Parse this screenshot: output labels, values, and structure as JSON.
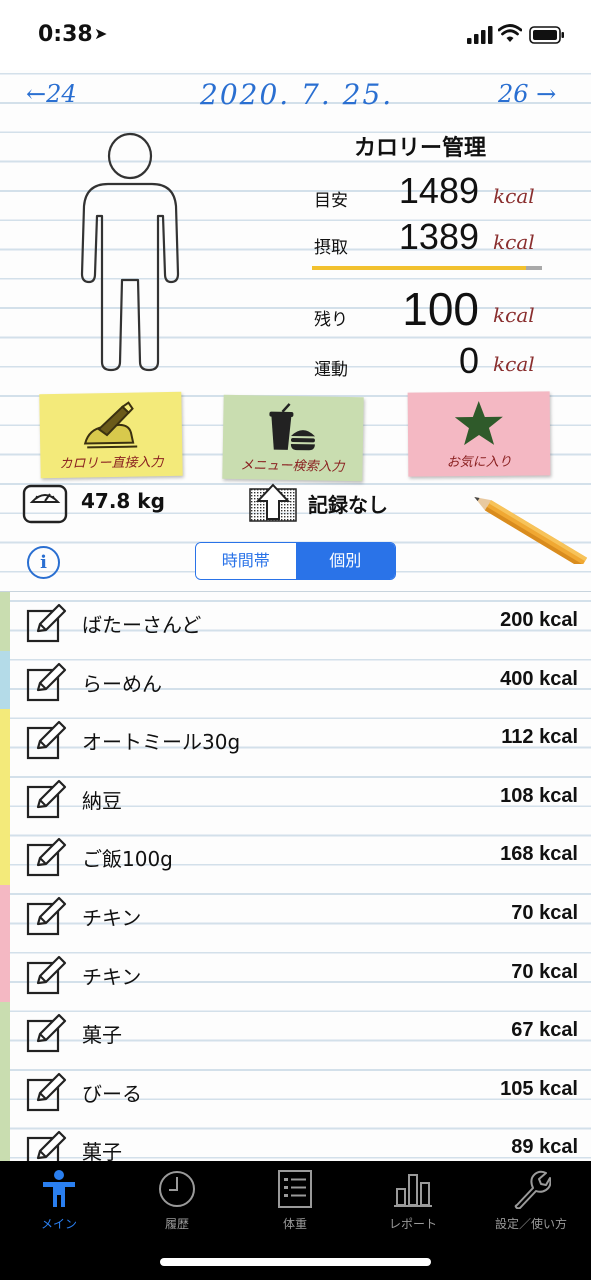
{
  "status": {
    "time": "0:38",
    "location_icon": "location-arrow-icon"
  },
  "date_nav": {
    "prev": "←24",
    "date": "2020. 7. 25.",
    "next": "26 →"
  },
  "calorie": {
    "title": "カロリー管理",
    "target_label": "目安",
    "target_value": "1489",
    "intake_label": "摂取",
    "intake_value": "1389",
    "remaining_label": "残り",
    "remaining_value": "100",
    "exercise_label": "運動",
    "exercise_value": "0",
    "unit": "kcal",
    "progress_fraction": 0.93,
    "progress_color": "#f2c12e"
  },
  "notes": {
    "direct": {
      "label": "カロリー直接入力",
      "color": "#f3ea7a",
      "icon": "hand-writing-icon"
    },
    "search": {
      "label": "メニュー検索入力",
      "color": "#c9ddb0",
      "icon": "food-drink-icon"
    },
    "favorite": {
      "label": "お気に入り",
      "color": "#f4b8c3",
      "icon": "star-icon"
    }
  },
  "weight": {
    "value": "47.8 kg",
    "record": "記録なし"
  },
  "segmented": {
    "time_period": "時間帯",
    "individual": "個別",
    "selected": "個別"
  },
  "meals": [
    {
      "name": "ばたーさんど",
      "kcal": "200 kcal",
      "color": "#c9ddb0"
    },
    {
      "name": "らーめん",
      "kcal": "400 kcal",
      "color": "#b4dbe8"
    },
    {
      "name": "オートミール30g",
      "kcal": "112 kcal",
      "color": "#f3ea7a"
    },
    {
      "name": "納豆",
      "kcal": "108 kcal",
      "color": "#f3ea7a"
    },
    {
      "name": "ご飯100g",
      "kcal": "168 kcal",
      "color": "#f3ea7a"
    },
    {
      "name": "チキン",
      "kcal": "70 kcal",
      "color": "#f4b8c3"
    },
    {
      "name": "チキン",
      "kcal": "70 kcal",
      "color": "#f4b8c3"
    },
    {
      "name": "菓子",
      "kcal": "67 kcal",
      "color": "#c9ddb0"
    },
    {
      "name": "びーる",
      "kcal": "105 kcal",
      "color": "#c9ddb0"
    },
    {
      "name": "菓子",
      "kcal": "89 kcal",
      "color": "#c9ddb0"
    }
  ],
  "tabs": [
    {
      "label": "メイン",
      "icon": "person-icon",
      "active": true
    },
    {
      "label": "履歴",
      "icon": "clock-icon",
      "active": false
    },
    {
      "label": "体重",
      "icon": "list-icon",
      "active": false
    },
    {
      "label": "レポート",
      "icon": "bar-chart-icon",
      "active": false
    },
    {
      "label": "設定／使い方",
      "icon": "wrench-icon",
      "active": false
    }
  ],
  "colors": {
    "accent": "#2a73e8",
    "kcal_unit": "#8a2f2f"
  }
}
